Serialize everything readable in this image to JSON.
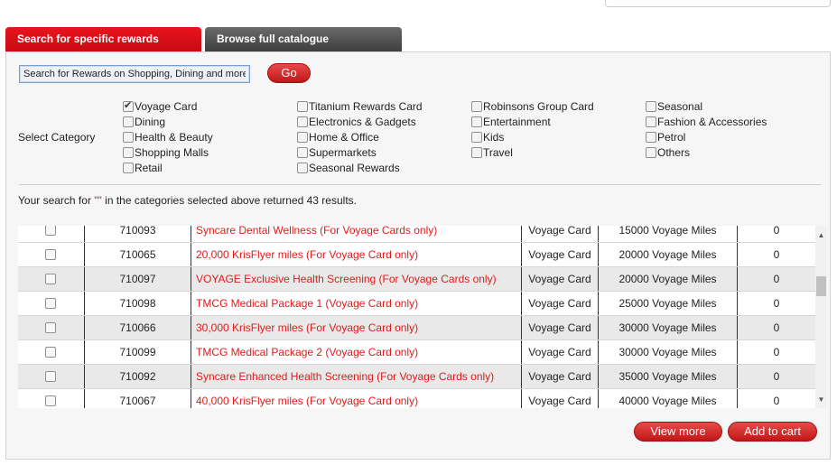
{
  "tabs": {
    "active_label": "Search for specific rewards",
    "inactive_label": "Browse full catalogue"
  },
  "search": {
    "value": "Search for Rewards on Shopping, Dining and more!",
    "go_label": "Go"
  },
  "categories": {
    "label": "Select Category",
    "items": [
      {
        "label": "Voyage Card",
        "checked": true
      },
      {
        "label": "Dining",
        "checked": false
      },
      {
        "label": "Health & Beauty",
        "checked": false
      },
      {
        "label": "Shopping Malls",
        "checked": false
      },
      {
        "label": "Retail",
        "checked": false
      },
      {
        "label": "Titanium Rewards Card",
        "checked": false
      },
      {
        "label": "Electronics & Gadgets",
        "checked": false
      },
      {
        "label": "Home & Office",
        "checked": false
      },
      {
        "label": "Supermarkets",
        "checked": false
      },
      {
        "label": "Seasonal Rewards",
        "checked": false
      },
      {
        "label": "Robinsons Group Card",
        "checked": false
      },
      {
        "label": "Entertainment",
        "checked": false
      },
      {
        "label": "Kids",
        "checked": false
      },
      {
        "label": "Travel",
        "checked": false
      },
      {
        "label": "Seasonal",
        "checked": false
      },
      {
        "label": "Fashion & Accessories",
        "checked": false
      },
      {
        "label": "Petrol",
        "checked": false
      },
      {
        "label": "Others",
        "checked": false
      }
    ]
  },
  "result": {
    "prefix": "Your search for ",
    "query": "\"\"",
    "suffix": " in the categories selected above returned 43 results."
  },
  "table": {
    "rows": [
      {
        "code": "710093",
        "name": "Syncare Dental Wellness (For Voyage Cards only)",
        "card": "Voyage Card",
        "miles": "15000 Voyage Miles",
        "cost": "0"
      },
      {
        "code": "710065",
        "name": "20,000 KrisFlyer miles (For Voyage Card only)",
        "card": "Voyage Card",
        "miles": "20000 Voyage Miles",
        "cost": "0"
      },
      {
        "code": "710097",
        "name": "VOYAGE Exclusive Health Screening (For Voyage Cards only)",
        "card": "Voyage Card",
        "miles": "20000 Voyage Miles",
        "cost": "0"
      },
      {
        "code": "710098",
        "name": "TMCG Medical Package 1 (Voyage Card only)",
        "card": "Voyage Card",
        "miles": "25000 Voyage Miles",
        "cost": "0"
      },
      {
        "code": "710066",
        "name": "30,000 KrisFlyer miles (For Voyage Card only)",
        "card": "Voyage Card",
        "miles": "30000 Voyage Miles",
        "cost": "0"
      },
      {
        "code": "710099",
        "name": "TMCG Medical Package 2 (Voyage Card only)",
        "card": "Voyage Card",
        "miles": "30000 Voyage Miles",
        "cost": "0"
      },
      {
        "code": "710092",
        "name": "Syncare Enhanced Health Screening (For Voyage Cards only)",
        "card": "Voyage Card",
        "miles": "35000 Voyage Miles",
        "cost": "0"
      },
      {
        "code": "710067",
        "name": "40,000 KrisFlyer miles (For Voyage Card only)",
        "card": "Voyage Card",
        "miles": "40000 Voyage Miles",
        "cost": "0"
      }
    ]
  },
  "actions": {
    "view_more": "View more",
    "add_to_cart": "Add to cart"
  },
  "colors": {
    "accent_red": "#d0121a",
    "link_red": "#e01b1b",
    "tab_inactive": "#4a4a4a"
  }
}
